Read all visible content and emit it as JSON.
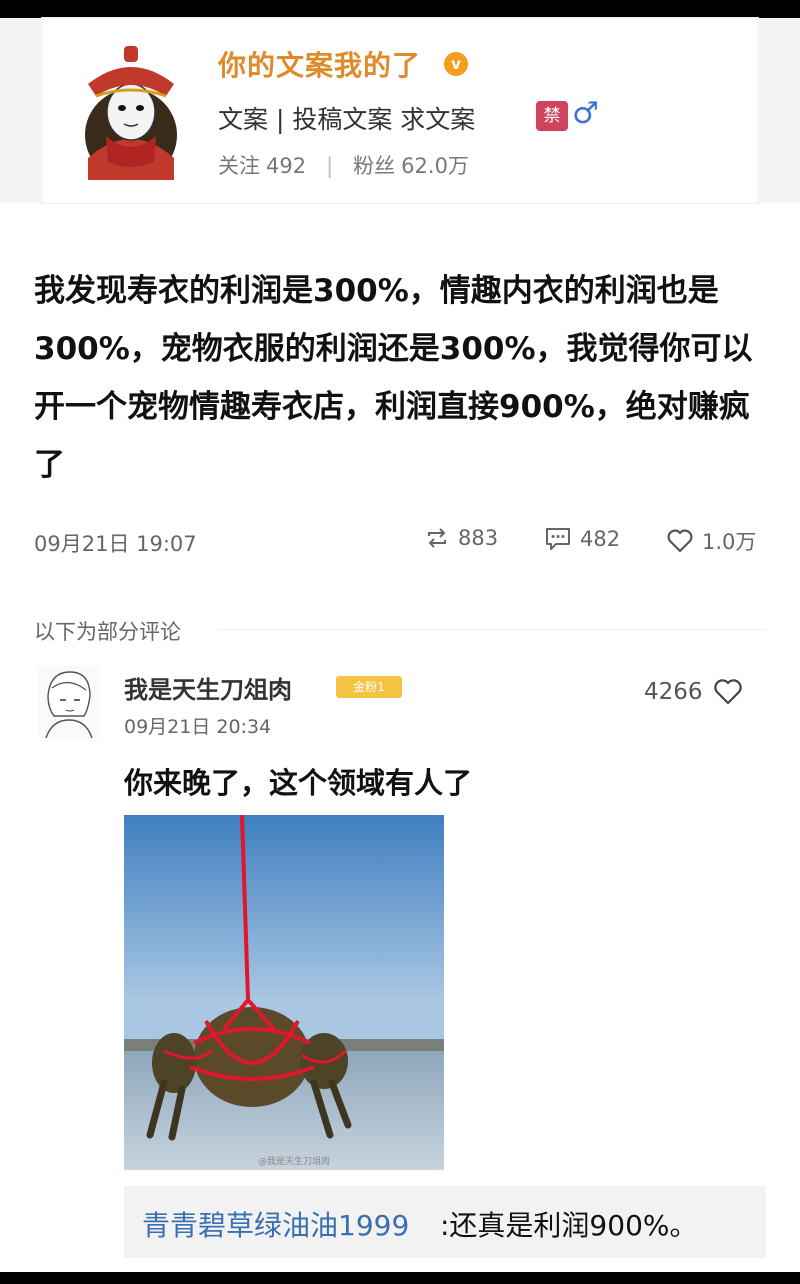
{
  "profile": {
    "nickname": "你的文案我的了",
    "vip_badge": "v",
    "tags": "文案 | 投稿文案  求文案",
    "ban_badge": "禁",
    "gender_icon": "♂",
    "follow_label": "关注",
    "follow_count": "492",
    "fans_label": "粉丝",
    "fans_count": "62.0万"
  },
  "post": {
    "text": "我发现寿衣的利润是300%，情趣内衣的利润也是300%，宠物衣服的利润还是300%，我觉得你可以开一个宠物情趣寿衣店，利润直接900%，绝对赚疯了",
    "time": "09月21日 19:07",
    "reposts": "883",
    "comments": "482",
    "likes": "1.0万"
  },
  "comments_header": "以下为部分评论",
  "comment": {
    "user": "我是天生刀俎肉",
    "fan_badge": "金粉1",
    "time": "09月21日 20:34",
    "likes": "4266",
    "text": "你来晚了，这个领域有人了",
    "image_watermark": "@我是天生刀俎肉",
    "reply_user": "青青碧草绿油油1999",
    "reply_text": ":还真是利润900%。"
  },
  "colors": {
    "nickname": "#e08a2a",
    "reply_user": "#3a6fb0",
    "ban_badge": "#d0435f",
    "fan_badge": "#f4c341"
  }
}
